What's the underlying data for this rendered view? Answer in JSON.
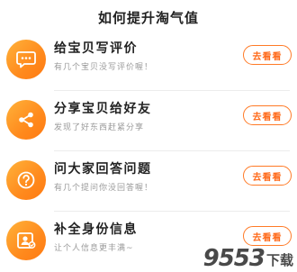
{
  "header": {
    "title": "如何提升淘气值"
  },
  "tasks": [
    {
      "title": "给宝贝写评价",
      "desc": "有几个宝贝没写评价喔！",
      "button": "去看看",
      "icon": "chat-bubble-icon"
    },
    {
      "title": "分享宝贝给好友",
      "desc": "发现了好东西赶紧分享",
      "button": "去看看",
      "icon": "share-icon"
    },
    {
      "title": "问大家回答问题",
      "desc": "有几个提问你没回答喔！",
      "button": "去看看",
      "icon": "question-icon"
    },
    {
      "title": "补全身份信息",
      "desc": "让个人信息更丰满~",
      "button": "去看看",
      "icon": "id-card-icon"
    }
  ],
  "watermark": {
    "digits": "9553",
    "sub": "下载"
  },
  "colors": {
    "accent": "#ff7a26",
    "icon_gradient_start": "#ffb23a",
    "icon_gradient_end": "#ff7a12",
    "title": "#222222",
    "desc": "#9a9a9a"
  }
}
